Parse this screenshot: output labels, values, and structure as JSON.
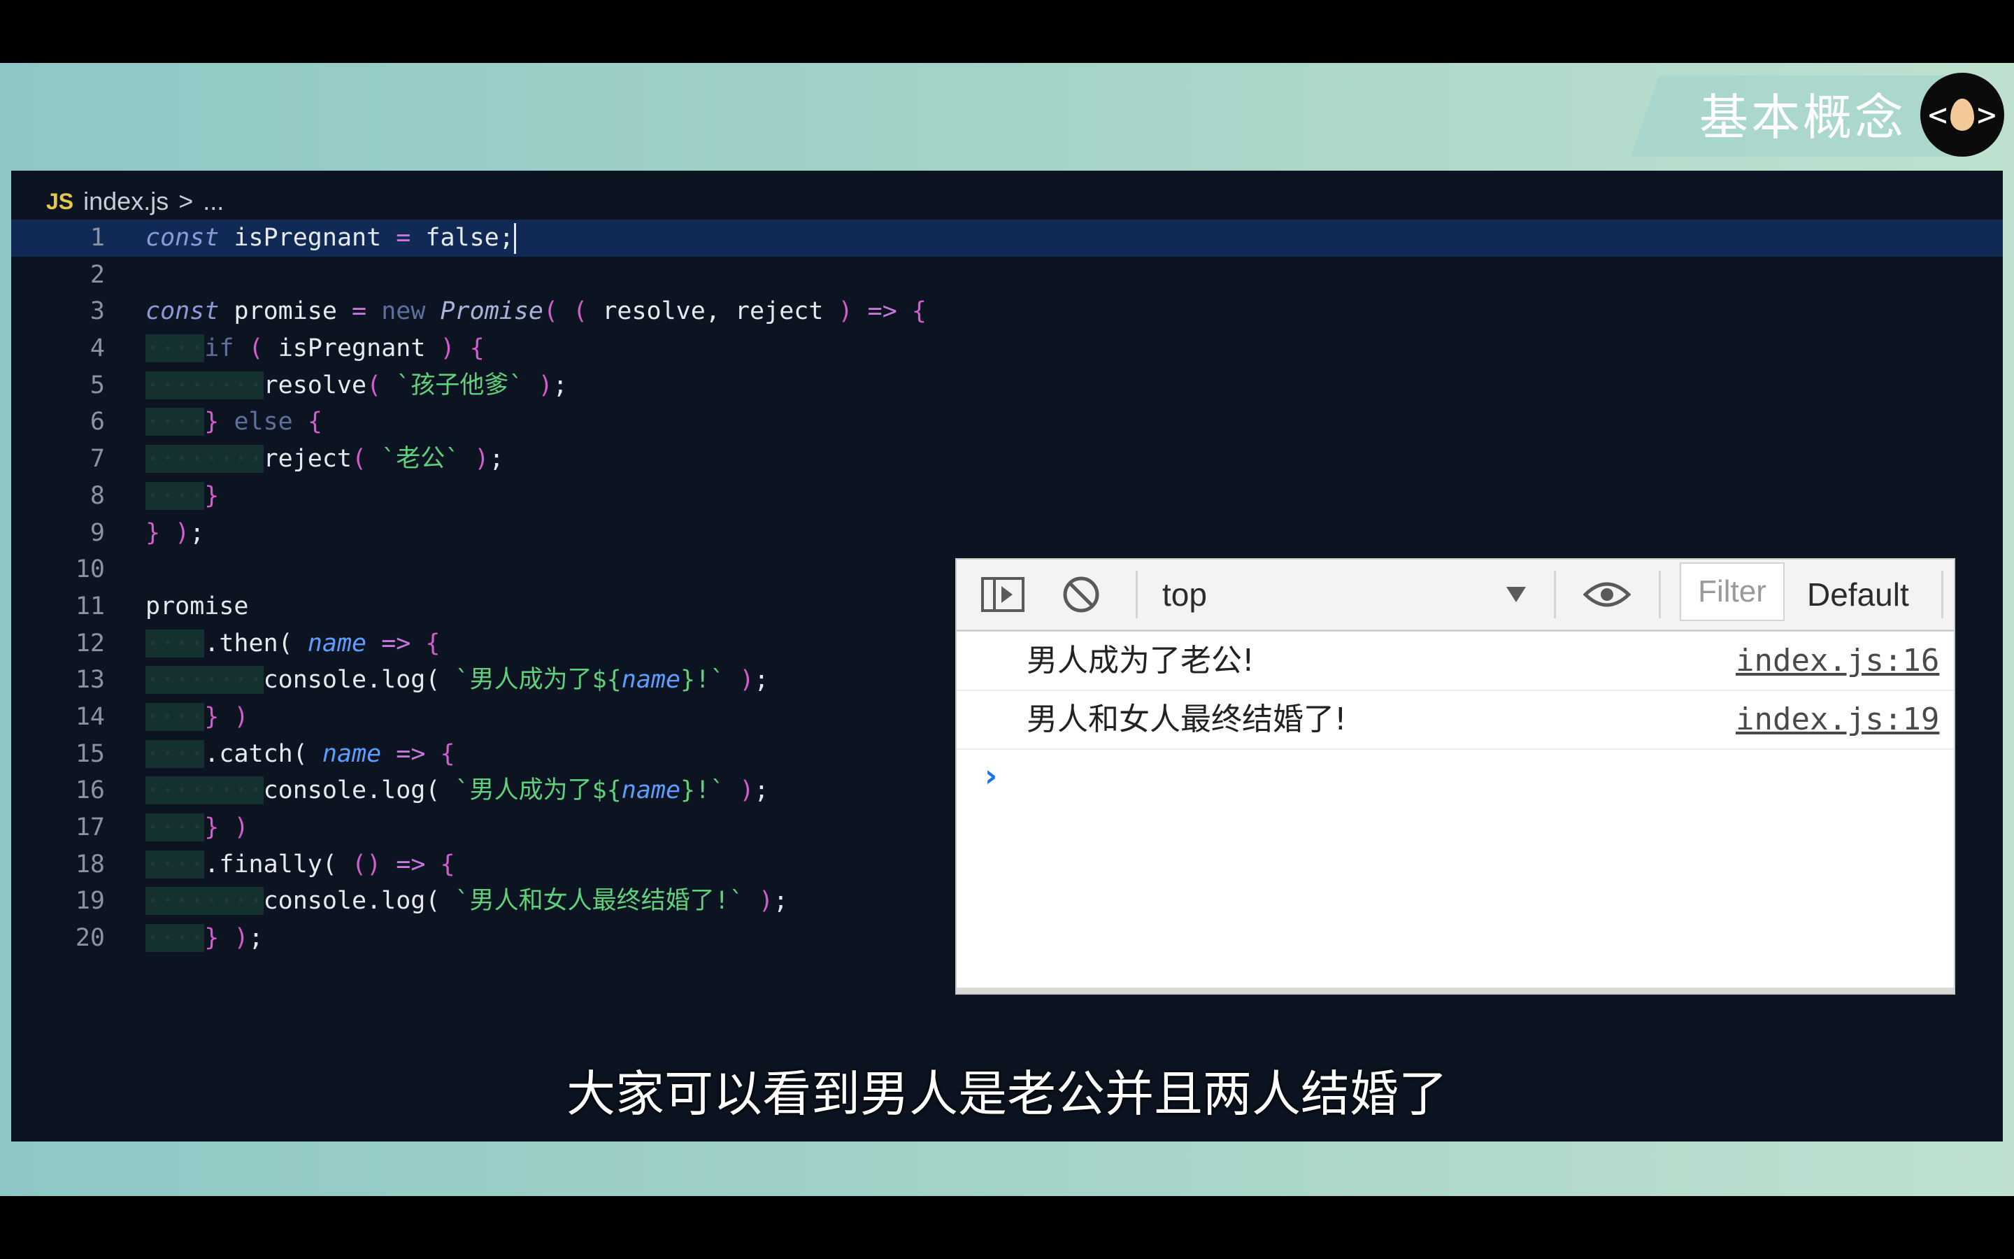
{
  "overlay": {
    "badge_title": "基本概念",
    "logo_left": "<",
    "logo_right": ">",
    "subtitle": "大家可以看到男人是老公并且两人结婚了"
  },
  "editor": {
    "file_icon": "JS",
    "breadcrumb_file": "index.js",
    "breadcrumb_sep": ">",
    "breadcrumb_more": "...",
    "line_numbers": [
      "1",
      "2",
      "3",
      "4",
      "5",
      "6",
      "7",
      "8",
      "9",
      "10",
      "11",
      "12",
      "13",
      "14",
      "15",
      "16",
      "17",
      "18",
      "19",
      "20"
    ],
    "tokens": {
      "const": "const",
      "isPregnant": "isPregnant",
      "eq": "=",
      "false": "false",
      "semi": ";",
      "promise": "promise",
      "new": "new",
      "Promise": "Promise",
      "resolve": "resolve",
      "reject": "reject",
      "arrow": "=>",
      "if": "if",
      "else": "else",
      "str_father": "`孩子他爹`",
      "str_husband": "`老公`",
      "then": ".then(",
      "catch": ".catch(",
      "finally": ".finally(",
      "name": "name",
      "console_log": "console.log(",
      "tpl_a": "`男人成为了${",
      "tpl_b": "}!`",
      "str_married": "`男人和女人最终结婚了!`"
    }
  },
  "console": {
    "context": "top",
    "filter_placeholder": "Filter",
    "levels": "Default",
    "messages": [
      {
        "text": "男人成为了老公!",
        "source": "index.js:16"
      },
      {
        "text": "男人和女人最终结婚了!",
        "source": "index.js:19"
      }
    ],
    "prompt": "›"
  }
}
